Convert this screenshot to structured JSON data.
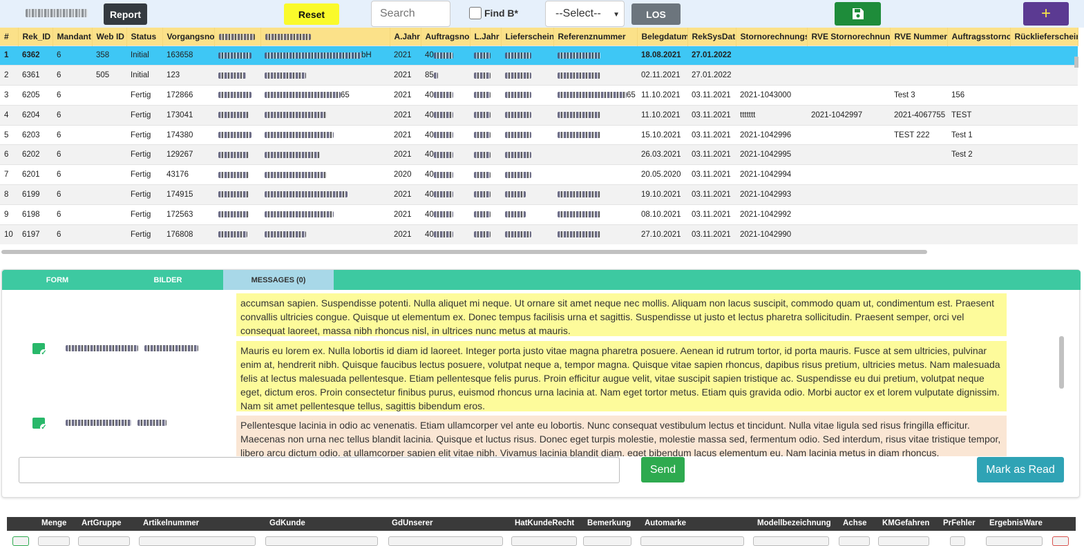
{
  "toolbar": {
    "report_label": "Report",
    "reset_label": "Reset",
    "search_placeholder": "Search",
    "findb_label": "Find B*",
    "select_value": "--Select--",
    "los_label": "LOS",
    "save_icon": "save-icon",
    "add_icon": "plus-icon",
    "add_label": "+"
  },
  "grid": {
    "columns": [
      "#",
      "Rek_ID",
      "Mandant",
      "Web ID",
      "Status",
      "Vorgangsno",
      "",
      "",
      "A.Jahr",
      "Auftragsno",
      "L.Jahr",
      "Lieferschein",
      "Referenznummer",
      "Belegdatum",
      "RekSysDat",
      "Stornorechnungs",
      "RVE Stornorechnung",
      "RVE Nummer",
      "Auftragsstorno",
      "Rücklieferschein"
    ],
    "rows": [
      {
        "n": "1",
        "rek": "6362",
        "mandant": "6",
        "web": "358",
        "status": "Initial",
        "vorg": "163658",
        "ajahr": "2021",
        "auftr": "40",
        "beleg": "18.08.2021",
        "rek_sys": "27.01.2022",
        "storno": "",
        "rve_storno": "",
        "rve_nr": "",
        "auftr_storno": "",
        "suffix": "bH"
      },
      {
        "n": "2",
        "rek": "6361",
        "mandant": "6",
        "web": "505",
        "status": "Initial",
        "vorg": "123",
        "ajahr": "2021",
        "auftr": "85",
        "beleg": "02.11.2021",
        "rek_sys": "27.01.2022",
        "storno": "",
        "rve_storno": "",
        "rve_nr": "",
        "auftr_storno": "",
        "suffix": ""
      },
      {
        "n": "3",
        "rek": "6205",
        "mandant": "6",
        "web": "",
        "status": "Fertig",
        "vorg": "172866",
        "ajahr": "2021",
        "auftr": "40",
        "beleg": "11.10.2021",
        "rek_sys": "03.11.2021",
        "storno": "2021-1043000",
        "rve_storno": "",
        "rve_nr": "Test 3",
        "auftr_storno": "156",
        "suffix": "65"
      },
      {
        "n": "4",
        "rek": "6204",
        "mandant": "6",
        "web": "",
        "status": "Fertig",
        "vorg": "173041",
        "ajahr": "2021",
        "auftr": "40",
        "beleg": "11.10.2021",
        "rek_sys": "03.11.2021",
        "storno": "ttttttt",
        "rve_storno": "2021-1042997",
        "rve_nr": "2021-4067755",
        "auftr_storno": "TEST",
        "suffix": ""
      },
      {
        "n": "5",
        "rek": "6203",
        "mandant": "6",
        "web": "",
        "status": "Fertig",
        "vorg": "174380",
        "ajahr": "2021",
        "auftr": "40",
        "beleg": "15.10.2021",
        "rek_sys": "03.11.2021",
        "storno": "2021-1042996",
        "rve_storno": "",
        "rve_nr": "TEST 222",
        "auftr_storno": "Test 1",
        "suffix": ""
      },
      {
        "n": "6",
        "rek": "6202",
        "mandant": "6",
        "web": "",
        "status": "Fertig",
        "vorg": "129267",
        "ajahr": "2021",
        "auftr": "40",
        "beleg": "26.03.2021",
        "rek_sys": "03.11.2021",
        "storno": "2021-1042995",
        "rve_storno": "",
        "rve_nr": "",
        "auftr_storno": "Test 2",
        "suffix": ""
      },
      {
        "n": "7",
        "rek": "6201",
        "mandant": "6",
        "web": "",
        "status": "Fertig",
        "vorg": "43176",
        "ajahr": "2020",
        "auftr": "40",
        "beleg": "20.05.2020",
        "rek_sys": "03.11.2021",
        "storno": "2021-1042994",
        "rve_storno": "",
        "rve_nr": "",
        "auftr_storno": "",
        "suffix": ""
      },
      {
        "n": "8",
        "rek": "6199",
        "mandant": "6",
        "web": "",
        "status": "Fertig",
        "vorg": "174915",
        "ajahr": "2021",
        "auftr": "40",
        "beleg": "19.10.2021",
        "rek_sys": "03.11.2021",
        "storno": "2021-1042993",
        "rve_storno": "",
        "rve_nr": "",
        "auftr_storno": "",
        "suffix": ""
      },
      {
        "n": "9",
        "rek": "6198",
        "mandant": "6",
        "web": "",
        "status": "Fertig",
        "vorg": "172563",
        "ajahr": "2021",
        "auftr": "40",
        "beleg": "08.10.2021",
        "rek_sys": "03.11.2021",
        "storno": "2021-1042992",
        "rve_storno": "",
        "rve_nr": "",
        "auftr_storno": "",
        "suffix": ""
      },
      {
        "n": "10",
        "rek": "6197",
        "mandant": "6",
        "web": "",
        "status": "Fertig",
        "vorg": "176808",
        "ajahr": "2021",
        "auftr": "40",
        "beleg": "27.10.2021",
        "rek_sys": "03.11.2021",
        "storno": "2021-1042990",
        "rve_storno": "",
        "rve_nr": "",
        "auftr_storno": "",
        "suffix": ""
      }
    ]
  },
  "tabs": {
    "form": "FORM",
    "bilder": "BILDER",
    "messages": "MESSAGES (0)"
  },
  "messages": [
    {
      "text": "accumsan sapien. Suspendisse potenti. Nulla aliquet mi neque. Ut ornare sit amet neque nec mollis. Aliquam non lacus suscipit, commodo quam ut, condimentum est. Praesent convallis ultricies congue. Quisque ut elementum ex. Donec tempus facilisis urna et sagittis. Suspendisse ut justo et lectus pharetra sollicitudin. Praesent semper, orci vel consequat laoreet, massa nibh rhoncus nisl, in ultrices nunc metus at mauris.",
      "color": "yellow"
    },
    {
      "text": "Mauris eu lorem ex. Nulla lobortis id diam id laoreet. Integer porta justo vitae magna pharetra posuere. Aenean id rutrum tortor, id porta mauris. Fusce at sem ultricies, pulvinar enim at, hendrerit nibh. Quisque faucibus lectus posuere, volutpat neque a, tempor magna. Quisque vitae sapien rhoncus, dapibus risus pretium, ultricies metus. Nam malesuada felis at lectus malesuada pellentesque. Etiam pellentesque felis purus. Proin efficitur augue velit, vitae suscipit sapien tristique ac. Suspendisse eu dui pretium, volutpat neque eget, dictum eros. Proin consectetur finibus purus, euismod rhoncus urna lacinia at. Nam eget tortor metus. Etiam quis gravida odio. Morbi auctor ex et lorem vulputate dignissim. Nam sit amet pellentesque tellus, sagittis bibendum eros.",
      "color": "yellow"
    },
    {
      "text": "Pellentesque lacinia in odio ac venenatis. Etiam ullamcorper vel ante eu lobortis. Nunc consequat vestibulum lectus et tincidunt. Nulla vitae ligula sed risus fringilla efficitur. Maecenas non urna nec tellus blandit lacinia. Quisque et luctus risus. Donec eget turpis molestie, molestie massa sed, fermentum odio. Sed interdum, risus vitae tristique tempor, libero arcu dictum odio, at ullamcorper sapien elit vitae nibh. Vivamus lacinia blandit diam, eget bibendum lacus elementum eu. Nam lacinia metus in diam rhoncus,",
      "color": "orange"
    }
  ],
  "compose": {
    "send_label": "Send",
    "mark_read_label": "Mark as Read"
  },
  "items_table": {
    "columns": [
      "Menge",
      "ArtGruppe",
      "Artikelnummer",
      "GdKunde",
      "GdUnserer",
      "HatKundeRecht",
      "Bemerkung",
      "Automarke",
      "Modellbezeichnung",
      "Achse",
      "KMGefahren",
      "PrFehler",
      "ErgebnisWare"
    ]
  },
  "colors": {
    "selected_row": "#3ec7f5",
    "header_bg": "#fbe189",
    "tabbar": "#3dc9a1",
    "save": "#1e8c3a",
    "add": "#5b3a92"
  }
}
